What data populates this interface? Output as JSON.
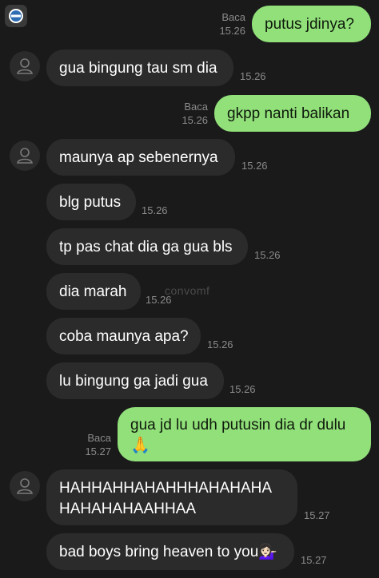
{
  "chat": {
    "read_label": "Baca",
    "watermark": "convomf",
    "messages": [
      {
        "text": "putus jdinya?",
        "time": "15.26",
        "read": "Baca"
      },
      {
        "text": "gua bingung tau sm dia",
        "time": "15.26"
      },
      {
        "text": "gkpp nanti balikan",
        "time": "15.26",
        "read": "Baca"
      },
      {
        "text": "maunya ap sebenernya",
        "time": "15.26"
      },
      {
        "text": "blg putus",
        "time": "15.26"
      },
      {
        "text": "tp pas chat dia ga gua bls",
        "time": "15.26"
      },
      {
        "text": "dia marah",
        "time": "15.26"
      },
      {
        "text": "coba maunya apa?",
        "time": "15.26"
      },
      {
        "text": "lu bingung ga jadi gua",
        "time": "15.26"
      },
      {
        "line1": "gua jd lu udh putusin dia dr dulu",
        "line2": "🙏",
        "time": "15.27",
        "read": "Baca"
      },
      {
        "line1": "HAHHAHHAHAHHHAHAHAHA",
        "line2": "HAHAHAHAAHHAA",
        "time": "15.27"
      },
      {
        "text": "bad boys bring heaven to you💁🏻‍♀️",
        "time": "15.27"
      }
    ]
  }
}
